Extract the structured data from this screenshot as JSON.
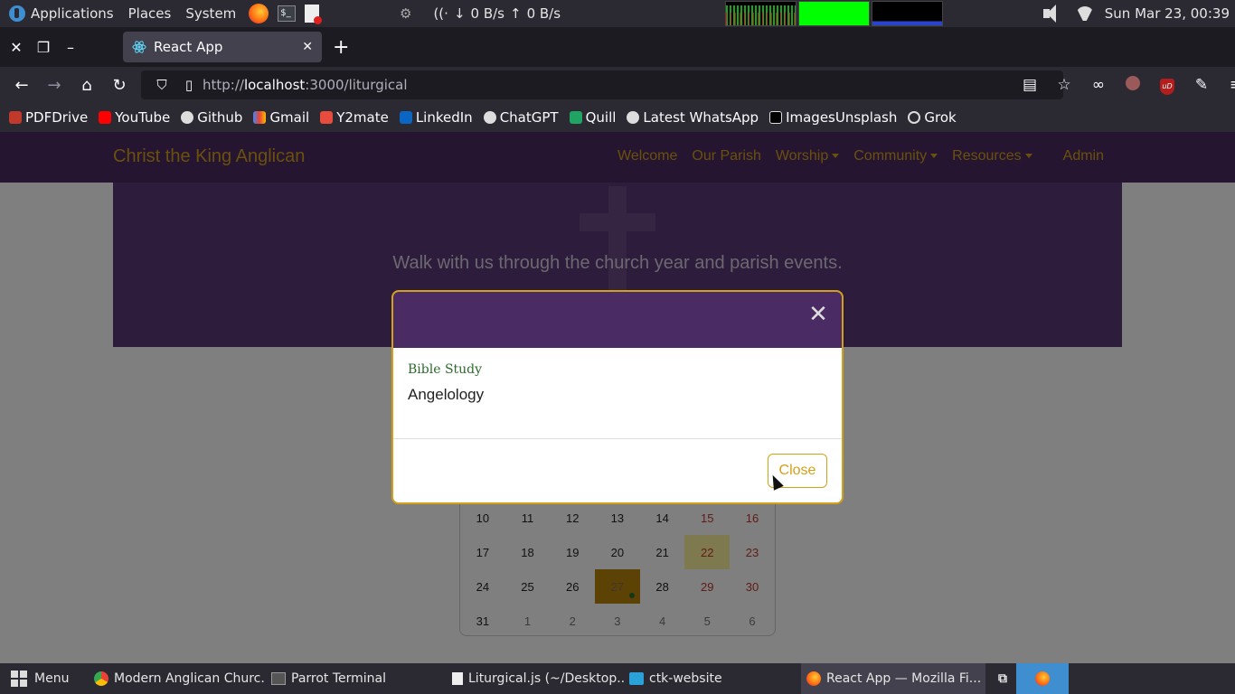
{
  "os_panel": {
    "menus": [
      "Applications",
      "Places",
      "System"
    ],
    "net_down": "0 B/s",
    "net_up": "0 B/s",
    "clock": "Sun Mar 23, 00:39"
  },
  "browser": {
    "tab_title": "React App",
    "url_host": "localhost",
    "url_prefix": "http://",
    "url_rest": ":3000/liturgical",
    "bookmarks": [
      "PDFDrive",
      "YouTube",
      "Github",
      "Gmail",
      "Y2mate",
      "LinkedIn",
      "ChatGPT",
      "Quill",
      "Latest WhatsApp",
      "ImagesUnsplash",
      "Grok"
    ]
  },
  "site": {
    "brand": "Christ the King Anglican",
    "nav": [
      "Welcome",
      "Our Parish",
      "Worship",
      "Community",
      "Resources",
      "Admin"
    ],
    "hero_text": "Walk with us through the church year and parish events."
  },
  "calendar": {
    "rows": [
      [
        "10",
        "11",
        "12",
        "13",
        "14",
        "15",
        "16"
      ],
      [
        "17",
        "18",
        "19",
        "20",
        "21",
        "22",
        "23"
      ],
      [
        "24",
        "25",
        "26",
        "27",
        "28",
        "29",
        "30"
      ],
      [
        "31",
        "1",
        "2",
        "3",
        "4",
        "5",
        "6"
      ]
    ]
  },
  "modal": {
    "event_type": "Bible Study",
    "event_description": "Angelology",
    "close_label": "Close"
  },
  "taskbar": {
    "menu_label": "Menu",
    "items": [
      "Modern Anglican Churc...",
      "Parrot Terminal",
      "Liturgical.js (~/Desktop...",
      "ctk-website",
      "React App — Mozilla Fi..."
    ]
  },
  "colors": {
    "site_purple": "#4a2b63",
    "accent_gold": "#d4a017",
    "event_green": "#2d6a2d"
  }
}
